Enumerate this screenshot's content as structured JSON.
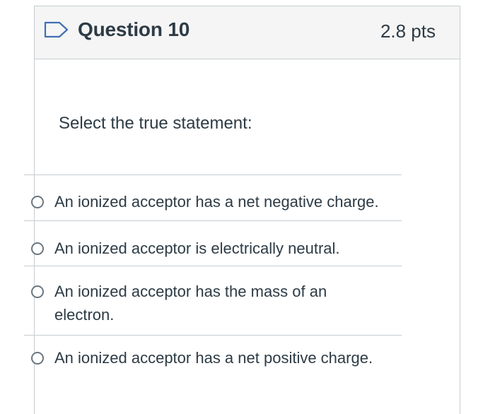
{
  "question": {
    "title": "Question 10",
    "points": "2.8 pts",
    "flag_icon": "flag-outline-icon",
    "prompt": "Select the true statement:"
  },
  "answers": [
    {
      "line1": "An ionized acceptor has a net negative charge.",
      "line2": ""
    },
    {
      "line1": "An ionized acceptor is electrically neutral.",
      "line2": ""
    },
    {
      "line1": "An ionized acceptor has the mass of an",
      "line2": "electron."
    },
    {
      "line1": "An ionized acceptor has a net positive charge.",
      "line2": ""
    }
  ],
  "colors": {
    "text": "#2d3b45",
    "border": "#c7cdd1",
    "header_bg": "#f5f5f5",
    "flag": "#3f6fb5"
  }
}
